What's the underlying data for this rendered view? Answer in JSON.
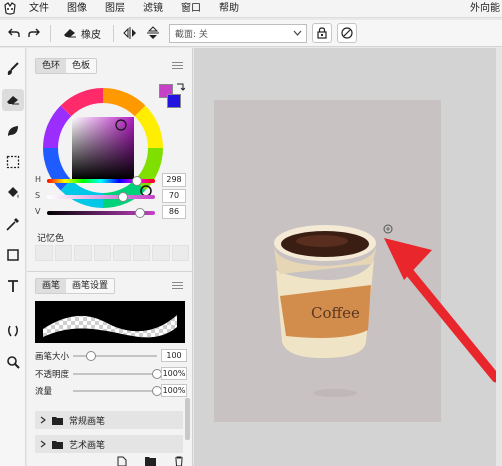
{
  "menubar": {
    "items": [
      "文件",
      "图像",
      "图层",
      "滤镜",
      "窗口",
      "帮助"
    ],
    "right_label": "外向能"
  },
  "toolbar": {
    "eraser_label": "橡皮",
    "cut_select_value": "截面: 关"
  },
  "color_panel": {
    "tabs": [
      "色环",
      "色板"
    ],
    "h_label": "H",
    "s_label": "S",
    "v_label": "V",
    "h_value": "298",
    "s_value": "70",
    "v_value": "86",
    "h_fraction": 0.83,
    "s_fraction": 0.7,
    "v_fraction": 0.86,
    "primary_color": "#c641c8",
    "secondary_color": "#2213e0",
    "memory_label": "记忆色"
  },
  "brush_panel": {
    "tabs": [
      "画笔",
      "画笔设置"
    ],
    "size_label": "画笔大小",
    "size_value": "100",
    "size_fraction": 0.22,
    "opacity_label": "不透明度",
    "opacity_value": "100%",
    "opacity_fraction": 1.0,
    "flow_label": "流量",
    "flow_value": "100%",
    "flow_fraction": 1.0,
    "groups": [
      "常规画笔",
      "艺术画笔"
    ]
  },
  "canvas": {
    "cup_text": "Coffee",
    "arrow_color": "#e8262b"
  }
}
